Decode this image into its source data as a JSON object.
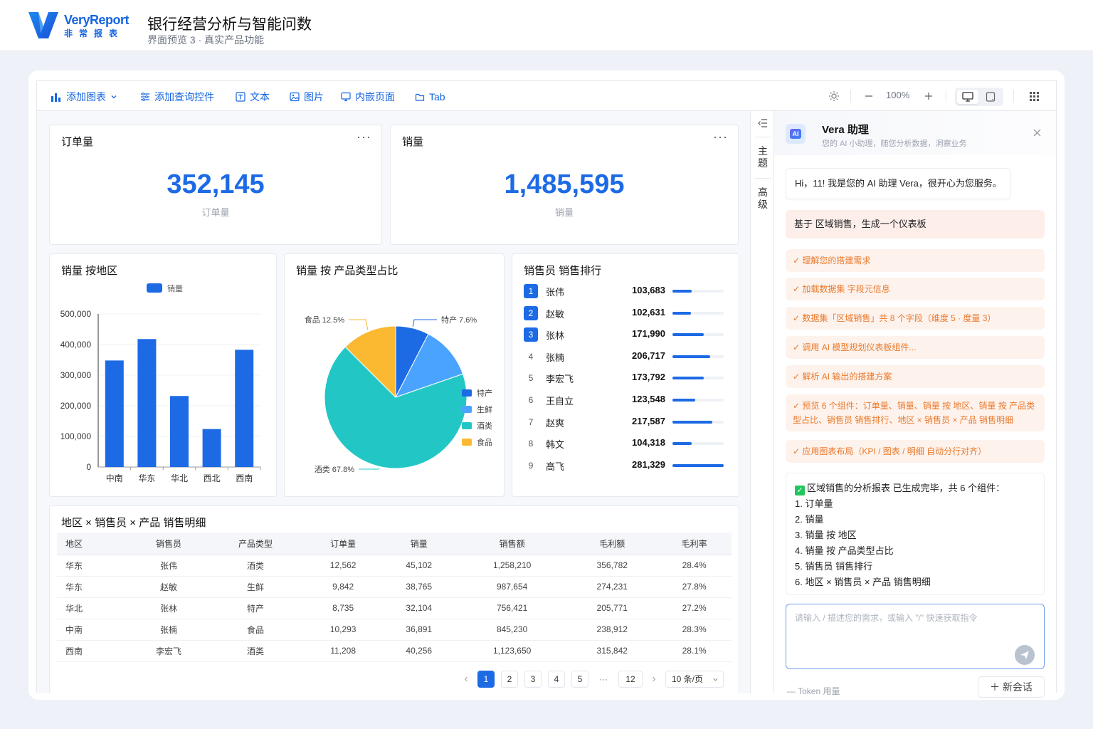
{
  "header": {
    "logo_en": "VeryReport",
    "logo_cn": "非常报表",
    "title": "银行经营分析与智能问数",
    "subtitle": "界面预览 3 · 真实产品功能"
  },
  "toolbar": {
    "add_chart": "添加图表",
    "add_query": "添加查询控件",
    "text": "文本",
    "image": "图片",
    "embed": "内嵌页面",
    "tab": "Tab",
    "zoom": "100%"
  },
  "kpi": [
    {
      "title": "订单量",
      "value": "352,145",
      "label": "订单量"
    },
    {
      "title": "销量",
      "value": "1,485,595",
      "label": "销量"
    }
  ],
  "more_icon": "···",
  "colors": {
    "accent": "#1d6ae5",
    "pie": [
      "#1d6ae5",
      "#4aa4ff",
      "#22c7c5",
      "#fbb931"
    ],
    "step_text": "#ea7a2c"
  },
  "chart_data": [
    {
      "type": "bar",
      "title": "销量 按地区",
      "legend": [
        "销量"
      ],
      "categories": [
        "中南",
        "华东",
        "华北",
        "西北",
        "西南"
      ],
      "series": [
        {
          "name": "销量",
          "values": [
            348000,
            418000,
            232000,
            124000,
            383000
          ]
        }
      ],
      "yticks": [
        "500,000",
        "400,000",
        "300,000",
        "200,000",
        "100,000",
        "0"
      ],
      "ylim": [
        0,
        500000
      ],
      "grid": true,
      "legend_position": "top"
    },
    {
      "type": "pie",
      "title": "销量 按 产品类型占比",
      "categories": [
        "特产",
        "生鲜",
        "酒类",
        "食品"
      ],
      "values": [
        7.6,
        12.1,
        67.8,
        12.5
      ],
      "data_labels": [
        "特产 7.6%",
        "食品 12.5%",
        "酒类 67.8%"
      ],
      "legend": [
        "特产",
        "生鲜",
        "酒类",
        "食品"
      ],
      "legend_position": "right"
    },
    {
      "type": "bar",
      "title": "销售员 销售排行",
      "rows": [
        {
          "rank": "1",
          "name": "张伟",
          "value": "103,683",
          "num": 103683
        },
        {
          "rank": "2",
          "name": "赵敏",
          "value": "102,631",
          "num": 102631
        },
        {
          "rank": "3",
          "name": "张林",
          "value": "171,990",
          "num": 171990
        },
        {
          "rank": "4",
          "name": "张楠",
          "value": "206,717",
          "num": 206717
        },
        {
          "rank": "5",
          "name": "李宏飞",
          "value": "173,792",
          "num": 173792
        },
        {
          "rank": "6",
          "name": "王自立",
          "value": "123,548",
          "num": 123548
        },
        {
          "rank": "7",
          "name": "赵爽",
          "value": "217,587",
          "num": 217587
        },
        {
          "rank": "8",
          "name": "韩文",
          "value": "104,318",
          "num": 104318
        },
        {
          "rank": "9",
          "name": "高飞",
          "value": "281,329",
          "num": 281329
        }
      ]
    }
  ],
  "table": {
    "title": "地区 × 销售员 × 产品 销售明细",
    "columns": [
      "地区",
      "销售员",
      "产品类型",
      "订单量",
      "销量",
      "销售额",
      "毛利额",
      "毛利率"
    ],
    "rows": [
      [
        "华东",
        "张伟",
        "酒类",
        "12,562",
        "45,102",
        "1,258,210",
        "356,782",
        "28.4%"
      ],
      [
        "华东",
        "赵敏",
        "生鲜",
        "9,842",
        "38,765",
        "987,654",
        "274,231",
        "27.8%"
      ],
      [
        "华北",
        "张林",
        "特产",
        "8,735",
        "32,104",
        "756,421",
        "205,771",
        "27.2%"
      ],
      [
        "中南",
        "张楠",
        "食品",
        "10,293",
        "36,891",
        "845,230",
        "238,912",
        "28.3%"
      ],
      [
        "西南",
        "李宏飞",
        "酒类",
        "11,208",
        "40,256",
        "1,123,650",
        "315,842",
        "28.1%"
      ]
    ]
  },
  "pager": {
    "prev": "‹",
    "pages": [
      "1",
      "2",
      "3",
      "4",
      "5"
    ],
    "ellipsis": "···",
    "last": "12",
    "next": "›",
    "size": "10 条/页"
  },
  "side_tabs": {
    "theme": "主题",
    "advanced": "高级"
  },
  "assistant": {
    "logo_text": "AI",
    "title": "Vera 助理",
    "subtitle": "您的 AI 小助理，随您分析数据，洞察业务",
    "greeting": "Hi，11! 我是您的 AI 助理 Vera，很开心为您服务。",
    "user_msg": "基于 区域销售，生成一个仪表板",
    "steps": [
      "✓ 理解您的搭建需求",
      "✓ 加载数据集 字段元信息",
      "✓ 数据集「区域销售」共 8 个字段（维度 5 · 度量 3）",
      "✓ 调用 AI 模型规划仪表板组件...",
      "✓ 解析 AI 输出的搭建方案",
      "✓ 预览 6 个组件：订单量、销量、销量 按 地区、销量 按 产品类型占比、销售员 销售排行、地区 × 销售员 × 产品 销售明细",
      "✓ 应用图表布局（KPI / 图表 / 明细 自动分行对齐）"
    ],
    "summary_title": "区域销售的分析报表 已生成完毕，共 6 个组件：",
    "summary_items": [
      "1. 订单量",
      "2. 销量",
      "3. 销量 按 地区",
      "4. 销量 按 产品类型占比",
      "5. 销售员 销售排行",
      "6. 地区 × 销售员 × 产品 销售明细"
    ],
    "input_placeholder": "请输入 / 描述您的需求，或输入 \"/\" 快速获取指令",
    "token_label": "— Token 用量",
    "new_chat": "＋ 新会话"
  }
}
